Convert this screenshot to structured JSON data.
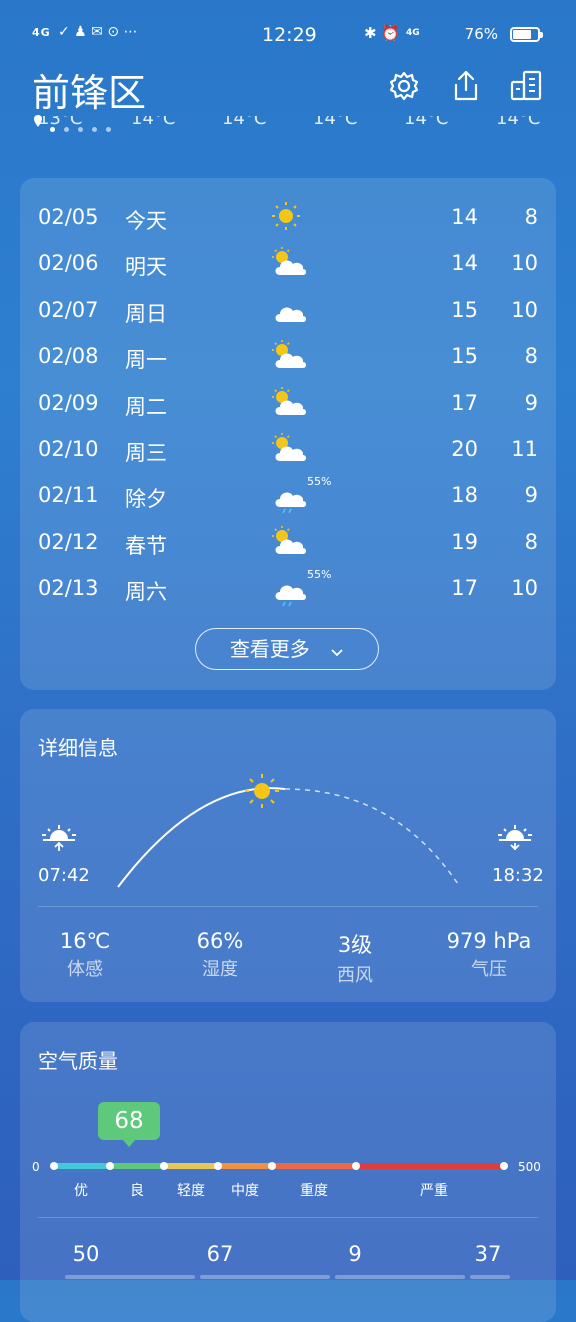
{
  "status_bar": {
    "network": "4G",
    "time": "12:29",
    "right_network": "4G",
    "battery": "76%",
    "battery_level": 0.76
  },
  "header": {
    "city": "前锋区",
    "icons": [
      "settings-icon",
      "share-icon",
      "city-list-icon"
    ]
  },
  "hourly_strip": [
    "13°C",
    "14°C",
    "14°C",
    "14°C",
    "14°C",
    "14°C"
  ],
  "forecast": [
    {
      "date": "02/05",
      "day": "今天",
      "icon": "sunny",
      "pct": "",
      "hi": "14",
      "lo": "8"
    },
    {
      "date": "02/06",
      "day": "明天",
      "icon": "partly-cloudy",
      "pct": "",
      "hi": "14",
      "lo": "10"
    },
    {
      "date": "02/07",
      "day": "周日",
      "icon": "cloudy",
      "pct": "",
      "hi": "15",
      "lo": "10"
    },
    {
      "date": "02/08",
      "day": "周一",
      "icon": "partly-cloudy",
      "pct": "",
      "hi": "15",
      "lo": "8"
    },
    {
      "date": "02/09",
      "day": "周二",
      "icon": "partly-cloudy",
      "pct": "",
      "hi": "17",
      "lo": "9"
    },
    {
      "date": "02/10",
      "day": "周三",
      "icon": "partly-cloudy",
      "pct": "",
      "hi": "20",
      "lo": "11"
    },
    {
      "date": "02/11",
      "day": "除夕",
      "icon": "rain",
      "pct": "55%",
      "hi": "18",
      "lo": "9"
    },
    {
      "date": "02/12",
      "day": "春节",
      "icon": "partly-cloudy",
      "pct": "",
      "hi": "19",
      "lo": "8"
    },
    {
      "date": "02/13",
      "day": "周六",
      "icon": "rain",
      "pct": "55%",
      "hi": "17",
      "lo": "10"
    }
  ],
  "more_button": "查看更多",
  "details": {
    "title": "详细信息",
    "sunrise": "07:42",
    "sunset": "18:32",
    "stats": [
      {
        "value": "16℃",
        "label": "体感"
      },
      {
        "value": "66%",
        "label": "湿度"
      },
      {
        "value": "3级",
        "label": "西风"
      },
      {
        "value": "979 hPa",
        "label": "气压"
      }
    ]
  },
  "air_quality": {
    "title": "空气质量",
    "aqi": "68",
    "scale_min": "0",
    "scale_max": "500",
    "levels": [
      "优",
      "良",
      "轻度",
      "中度",
      "重度",
      "严重"
    ],
    "level_colors": [
      "#45c8d8",
      "#5ec97a",
      "#e6c85a",
      "#f09040",
      "#ea6a48",
      "#dc3d3d"
    ],
    "pollutants": [
      "50",
      "67",
      "9",
      "37"
    ]
  }
}
